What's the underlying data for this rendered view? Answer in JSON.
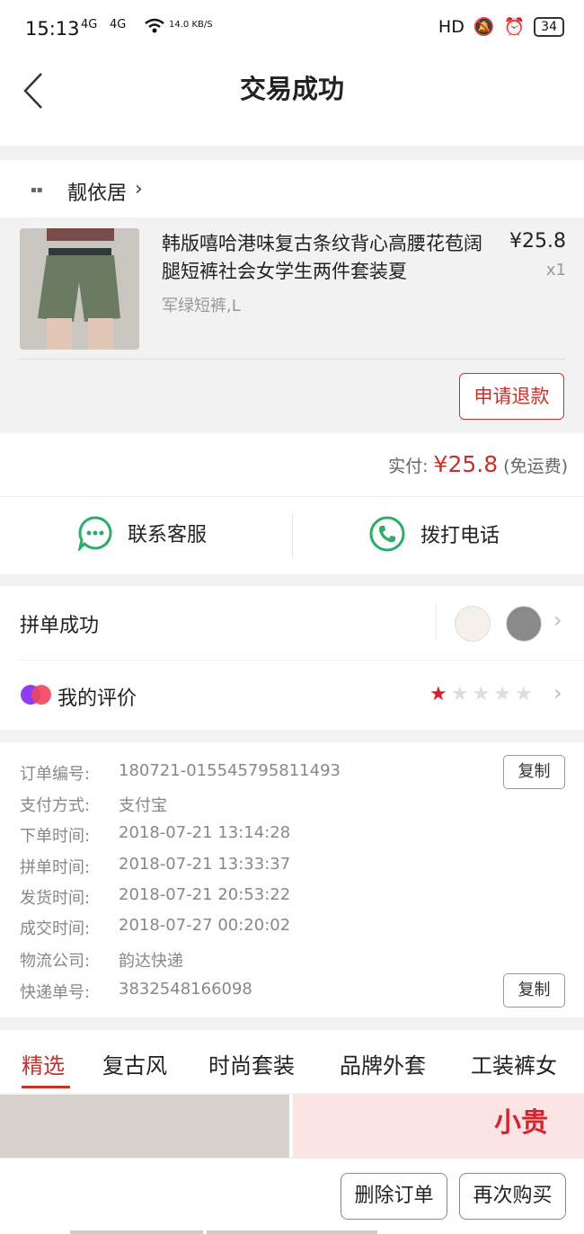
{
  "status_bar": {
    "time": "15:13",
    "signal1": "4G",
    "signal2": "4G",
    "net_speed": "14.0 KB/S",
    "hd": "HD",
    "battery": "34"
  },
  "header": {
    "title": "交易成功"
  },
  "shop": {
    "name": "靓依居"
  },
  "product": {
    "title": "韩版嘻哈港味复古条纹背心高腰花苞阔腿短裤社会女学生两件套装夏",
    "variant": "军绿短裤,L",
    "price": "¥25.8",
    "qty": "x1",
    "refund_label": "申请退款"
  },
  "payment": {
    "label": "实付:",
    "currency": "¥",
    "amount": "25.8",
    "note": "(免运费)"
  },
  "contact": {
    "service_label": "联系客服",
    "phone_label": "拨打电话"
  },
  "group": {
    "label": "拼单成功"
  },
  "review": {
    "label": "我的评价",
    "rating": 1,
    "max": 5
  },
  "order_info": {
    "rows": [
      {
        "key": "订单编号:",
        "value": "180721-015545795811493"
      },
      {
        "key": "支付方式:",
        "value": "支付宝"
      },
      {
        "key": "下单时间:",
        "value": "2018-07-21 13:14:28"
      },
      {
        "key": "拼单时间:",
        "value": "2018-07-21 13:33:37"
      },
      {
        "key": "发货时间:",
        "value": "2018-07-21 20:53:22"
      },
      {
        "key": "成交时间:",
        "value": "2018-07-27 00:20:02"
      },
      {
        "key": "物流公司:",
        "value": "韵达快递"
      },
      {
        "key": "快递单号:",
        "value": "3832548166098"
      }
    ],
    "copy_label": "复制"
  },
  "tabs": [
    "精选",
    "复古风",
    "时尚套装",
    "品牌外套",
    "工装裤女"
  ],
  "feed": {
    "right_banner_text": "小贵"
  },
  "bottom": {
    "delete_label": "删除订单",
    "rebuy_label": "再次购买"
  },
  "colors": {
    "accent": "#c8312b",
    "wechat_green": "#2aae67"
  }
}
